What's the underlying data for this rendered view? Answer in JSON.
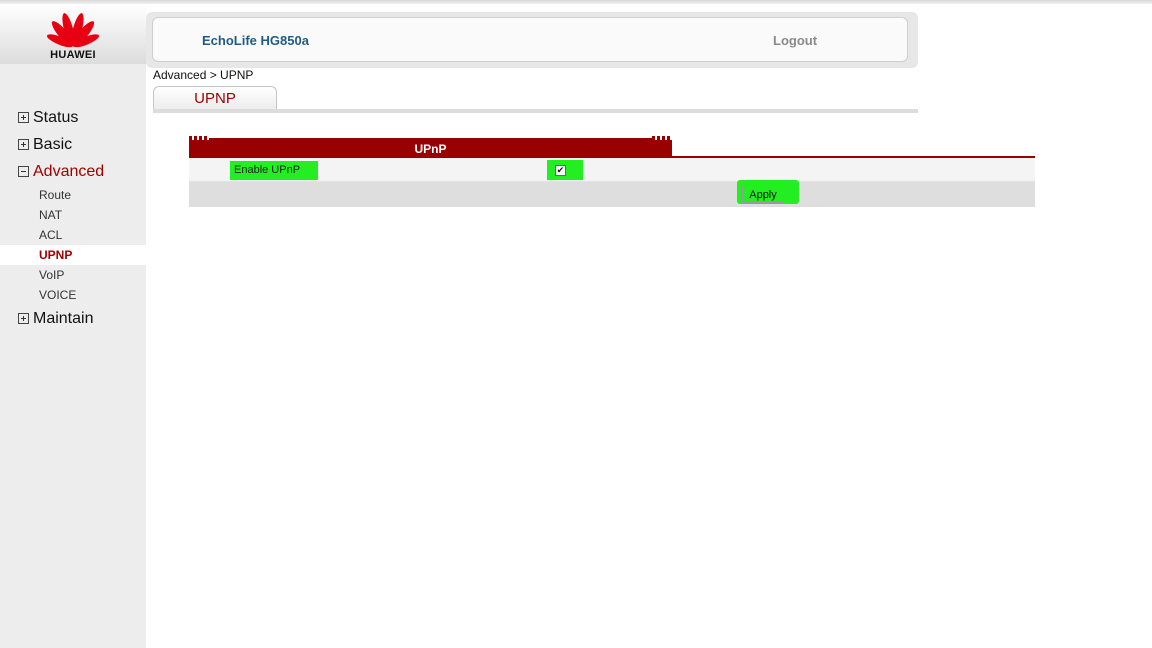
{
  "brand": {
    "name": "HUAWEI",
    "accent": "#e60012"
  },
  "header": {
    "product": "EchoLife HG850a",
    "logout": "Logout"
  },
  "breadcrumb": "Advanced > UPNP",
  "tab": {
    "label": "UPNP"
  },
  "sidebar": {
    "groups": [
      {
        "label": "Status",
        "expanded": false
      },
      {
        "label": "Basic",
        "expanded": false
      },
      {
        "label": "Advanced",
        "expanded": true,
        "items": [
          "Route",
          "NAT",
          "ACL",
          "UPNP",
          "VoIP",
          "VOICE"
        ],
        "active_item": "UPNP"
      },
      {
        "label": "Maintain",
        "expanded": false
      }
    ]
  },
  "panel": {
    "title": "UPnP",
    "enable_label": "Enable UPnP",
    "enable_checked": true,
    "check_mark": "✔",
    "apply_label": "Apply"
  },
  "colors": {
    "dark_red": "#990000",
    "active_text": "#a00000",
    "highlight": "#22ee22",
    "product_blue": "#1f5b87"
  }
}
